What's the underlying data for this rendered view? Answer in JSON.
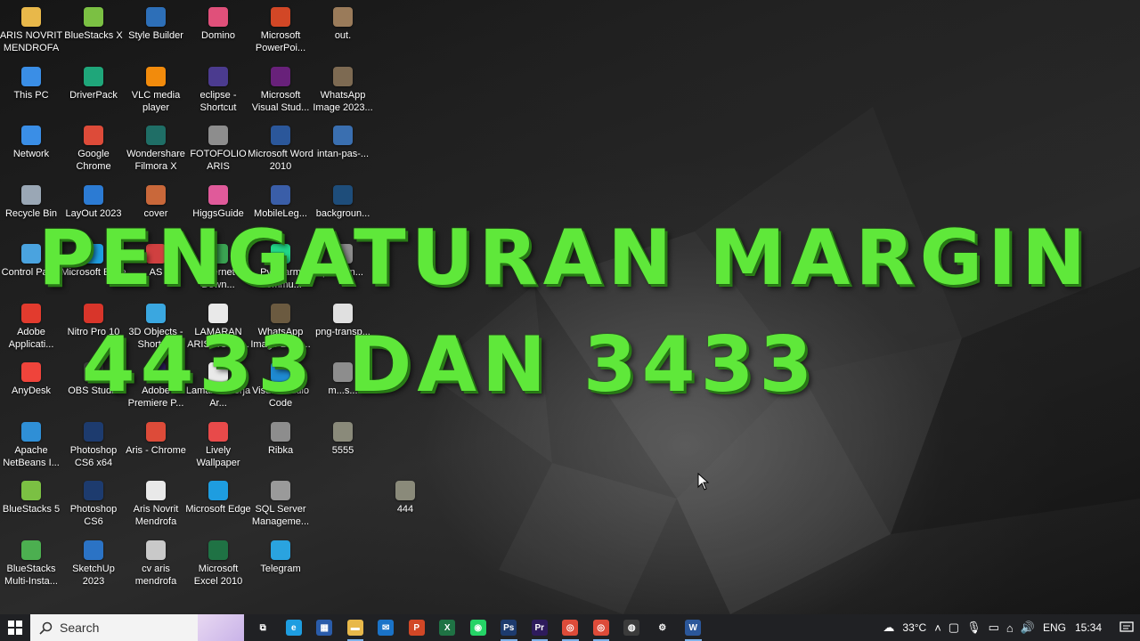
{
  "desktop_icons": [
    {
      "label": "ARIS NOVRIT MENDROFA",
      "icon": "folder-user-icon",
      "color": "#e8b84a"
    },
    {
      "label": "This PC",
      "icon": "computer-icon",
      "color": "#3a8ee6"
    },
    {
      "label": "Network",
      "icon": "network-icon",
      "color": "#3a8ee6"
    },
    {
      "label": "Recycle Bin",
      "icon": "recycle-bin-icon",
      "color": "#9aa7b5"
    },
    {
      "label": "Control Panel",
      "icon": "control-panel-icon",
      "color": "#4aa3df"
    },
    {
      "label": "Adobe Applicati...",
      "icon": "adobe-icon",
      "color": "#e23b2e"
    },
    {
      "label": "AnyDesk",
      "icon": "anydesk-icon",
      "color": "#ef443b"
    },
    {
      "label": "Apache NetBeans I...",
      "icon": "netbeans-icon",
      "color": "#2f8fd6"
    },
    {
      "label": "BlueStacks 5",
      "icon": "bluestacks-icon",
      "color": "#7bc043"
    },
    {
      "label": "BlueStacks Multi-Insta...",
      "icon": "bluestacks-multi-icon",
      "color": "#4caf50"
    },
    {
      "label": "BlueStacks X",
      "icon": "bluestacks-x-icon",
      "color": "#7bc043"
    },
    {
      "label": "DriverPack",
      "icon": "driverpack-icon",
      "color": "#1fa67a"
    },
    {
      "label": "Google Chrome",
      "icon": "chrome-icon",
      "color": "#dd4b39"
    },
    {
      "label": "LayOut 2023",
      "icon": "layout-icon",
      "color": "#2c7bd3"
    },
    {
      "label": "Microsoft Edge",
      "icon": "edge-icon",
      "color": "#1e9de0"
    },
    {
      "label": "Nitro Pro 10",
      "icon": "nitro-icon",
      "color": "#d8352a"
    },
    {
      "label": "OBS Studio",
      "icon": "obs-icon",
      "color": "#3b3b3b"
    },
    {
      "label": "Photoshop CS6 x64",
      "icon": "photoshop-icon",
      "color": "#1d3b6e"
    },
    {
      "label": "Photoshop CS6",
      "icon": "photoshop-icon",
      "color": "#1d3b6e"
    },
    {
      "label": "SketchUp 2023",
      "icon": "sketchup-icon",
      "color": "#2b73c5"
    },
    {
      "label": "Style Builder",
      "icon": "style-builder-icon",
      "color": "#2d6fb8"
    },
    {
      "label": "VLC media player",
      "icon": "vlc-icon",
      "color": "#f28b0c"
    },
    {
      "label": "Wondershare Filmora X",
      "icon": "filmora-icon",
      "color": "#1f6e66"
    },
    {
      "label": "cover",
      "icon": "document-image-icon",
      "color": "#c9683a"
    },
    {
      "label": "AS",
      "icon": "folder-icon",
      "color": "#d04040"
    },
    {
      "label": "3D Objects - Shortcut",
      "icon": "3d-objects-icon",
      "color": "#3aa7e0"
    },
    {
      "label": "Adobe Premiere P...",
      "icon": "premiere-icon",
      "color": "#2e1b5c"
    },
    {
      "label": "Aris - Chrome",
      "icon": "chrome-icon",
      "color": "#dd4b39"
    },
    {
      "label": "Aris Novrit Mendrofa",
      "icon": "document-icon",
      "color": "#e9e9e9"
    },
    {
      "label": "cv aris mendrofa",
      "icon": "document-image-icon",
      "color": "#c9c9c9"
    },
    {
      "label": "Domino",
      "icon": "domino-icon",
      "color": "#e0507a"
    },
    {
      "label": "eclipse - Shortcut",
      "icon": "eclipse-icon",
      "color": "#4b3b8f"
    },
    {
      "label": "FOTOFOLIO ARIS",
      "icon": "image-icon",
      "color": "#8d8d8d"
    },
    {
      "label": "HiggsGuide",
      "icon": "higgs-icon",
      "color": "#e05a9a"
    },
    {
      "label": "Internet Down...",
      "icon": "download-icon",
      "color": "#3aa352"
    },
    {
      "label": "LAMARAN ARIS NOVR...",
      "icon": "document-icon",
      "color": "#e9e9e9"
    },
    {
      "label": "Lamaran Kerja Ar...",
      "icon": "document-icon",
      "color": "#e9e9e9"
    },
    {
      "label": "Lively Wallpaper",
      "icon": "lively-icon",
      "color": "#e84a4a"
    },
    {
      "label": "Microsoft Edge",
      "icon": "edge-icon",
      "color": "#1e9de0"
    },
    {
      "label": "Microsoft Excel 2010",
      "icon": "excel-icon",
      "color": "#1f7244"
    },
    {
      "label": "Microsoft PowerPoi...",
      "icon": "powerpoint-icon",
      "color": "#d24726"
    },
    {
      "label": "Microsoft Visual Stud...",
      "icon": "visual-studio-icon",
      "color": "#68217a"
    },
    {
      "label": "Microsoft Word 2010",
      "icon": "word-icon",
      "color": "#2b579a"
    },
    {
      "label": "MobileLeg...",
      "icon": "game-icon",
      "color": "#3a5ea8"
    },
    {
      "label": "PyCharm Commu...",
      "icon": "pycharm-icon",
      "color": "#21d789"
    },
    {
      "label": "WhatsApp Image 2023...",
      "icon": "image-icon",
      "color": "#6b5a40"
    },
    {
      "label": "Visual Studio Code",
      "icon": "vscode-icon",
      "color": "#1f8ad2"
    },
    {
      "label": "Ribka",
      "icon": "image-icon",
      "color": "#8d8d8d"
    },
    {
      "label": "SQL Server Manageme...",
      "icon": "sql-server-icon",
      "color": "#9a9a9a"
    },
    {
      "label": "Telegram",
      "icon": "telegram-icon",
      "color": "#2aa3df"
    },
    {
      "label": "out.",
      "icon": "image-icon",
      "color": "#9a7b5a"
    },
    {
      "label": "WhatsApp Image 2023...",
      "icon": "image-icon",
      "color": "#7d6a52"
    },
    {
      "label": "intan-pas-...",
      "icon": "image-icon",
      "color": "#3a6fb0"
    },
    {
      "label": "backgroun...",
      "icon": "image-icon",
      "color": "#1e4d7a"
    },
    {
      "label": "pengen...",
      "icon": "image-icon",
      "color": "#8d8d8d"
    },
    {
      "label": "png-transp...",
      "icon": "image-icon",
      "color": "#e0e0e0"
    },
    {
      "label": "m...s...",
      "icon": "image-icon",
      "color": "#8d8d8d"
    },
    {
      "label": "5555",
      "icon": "image-icon",
      "color": "#8a8a7a"
    },
    {
      "label": "444",
      "icon": "image-icon",
      "color": "#8a8a7a"
    }
  ],
  "headline": {
    "line1": "PENGATURAN MARGIN",
    "line2": "4433 DAN 3433",
    "color": "#5fe83a"
  },
  "taskbar": {
    "search_placeholder": "Search",
    "apps": [
      {
        "name": "task-view",
        "icon": "task-view-icon",
        "glyph": "⧉",
        "color": "#202124",
        "active": false
      },
      {
        "name": "edge",
        "icon": "edge-icon",
        "glyph": "e",
        "color": "#1e9de0",
        "active": false
      },
      {
        "name": "store",
        "icon": "store-icon",
        "glyph": "▦",
        "color": "#2a5caa",
        "active": false
      },
      {
        "name": "file-explorer",
        "icon": "folder-icon",
        "glyph": "▬",
        "color": "#e8b84a",
        "active": true
      },
      {
        "name": "mail",
        "icon": "mail-icon",
        "glyph": "✉",
        "color": "#1a73c8",
        "active": false
      },
      {
        "name": "powerpoint",
        "icon": "powerpoint-icon",
        "glyph": "P",
        "color": "#d24726",
        "active": false
      },
      {
        "name": "excel",
        "icon": "excel-icon",
        "glyph": "X",
        "color": "#1f7244",
        "active": false
      },
      {
        "name": "whatsapp",
        "icon": "whatsapp-icon",
        "glyph": "◉",
        "color": "#25d366",
        "active": false
      },
      {
        "name": "photoshop",
        "icon": "photoshop-icon",
        "glyph": "Ps",
        "color": "#1d3b6e",
        "active": true
      },
      {
        "name": "premiere",
        "icon": "premiere-icon",
        "glyph": "Pr",
        "color": "#2e1b5c",
        "active": true
      },
      {
        "name": "chrome",
        "icon": "chrome-icon",
        "glyph": "◎",
        "color": "#dd4b39",
        "active": true
      },
      {
        "name": "chrome-2",
        "icon": "chrome-icon",
        "glyph": "◎",
        "color": "#dd4b39",
        "active": true
      },
      {
        "name": "obs",
        "icon": "obs-icon",
        "glyph": "◍",
        "color": "#3b3b3b",
        "active": false
      },
      {
        "name": "settings",
        "icon": "gear-icon",
        "glyph": "⚙",
        "color": "#202124",
        "active": false
      },
      {
        "name": "word",
        "icon": "word-icon",
        "glyph": "W",
        "color": "#2b579a",
        "active": true
      }
    ],
    "weather": "33°C",
    "language": "ENG",
    "time": "15:34"
  }
}
